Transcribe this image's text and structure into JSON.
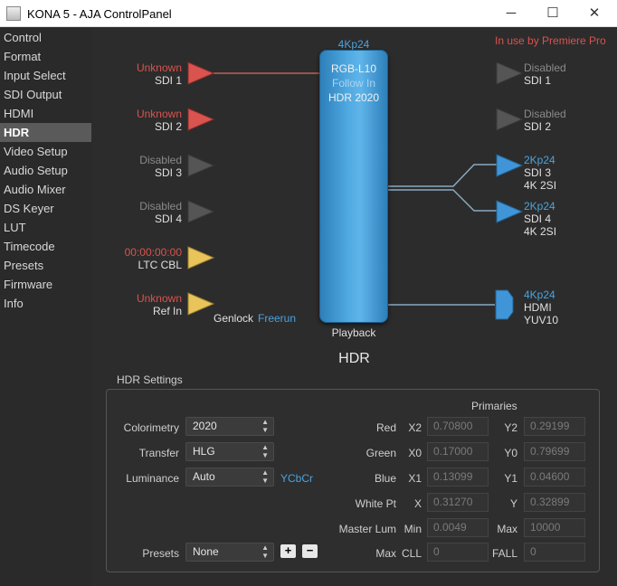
{
  "window": {
    "title": "KONA 5 - AJA ControlPanel",
    "minimize": "─",
    "maximize": "☐",
    "close": "✕"
  },
  "sidebar": {
    "items": [
      {
        "label": "Control"
      },
      {
        "label": "Format"
      },
      {
        "label": "Input Select"
      },
      {
        "label": "SDI Output"
      },
      {
        "label": "HDMI"
      },
      {
        "label": "HDR"
      },
      {
        "label": "Video Setup"
      },
      {
        "label": "Audio Setup"
      },
      {
        "label": "Audio Mixer"
      },
      {
        "label": "DS Keyer"
      },
      {
        "label": "LUT"
      },
      {
        "label": "Timecode"
      },
      {
        "label": "Presets"
      },
      {
        "label": "Firmware"
      },
      {
        "label": "Info"
      }
    ],
    "active": "HDR"
  },
  "status": {
    "in_use": "In use by Premiere Pro"
  },
  "inputs": [
    {
      "status": "Unknown",
      "name": "SDI 1",
      "color": "#d9534f"
    },
    {
      "status": "Unknown",
      "name": "SDI 2",
      "color": "#d9534f"
    },
    {
      "status": "Disabled",
      "name": "SDI 3",
      "color": "#555555"
    },
    {
      "status": "Disabled",
      "name": "SDI 4",
      "color": "#555555"
    },
    {
      "status": "00:00:00:00",
      "name": "LTC CBL",
      "color": "#e8c45a"
    },
    {
      "status": "Unknown",
      "name": "Ref In",
      "color": "#e8c45a"
    }
  ],
  "genlock": {
    "label": "Genlock",
    "value": "Freerun"
  },
  "processor": {
    "format": "4Kp24",
    "line1": "RGB-L10",
    "line2": "Follow In",
    "line3": "HDR 2020",
    "mode": "Playback"
  },
  "outputs": [
    {
      "status": "Disabled",
      "name": "SDI 1",
      "extra": ""
    },
    {
      "status": "Disabled",
      "name": "SDI 2",
      "extra": ""
    },
    {
      "status": "2Kp24",
      "name": "SDI 3",
      "extra": "4K 2SI"
    },
    {
      "status": "2Kp24",
      "name": "SDI 4",
      "extra": "4K 2SI"
    },
    {
      "status": "4Kp24",
      "name": "HDMI",
      "extra": "YUV10"
    }
  ],
  "section_title": "HDR",
  "hdr_settings": {
    "group_label": "HDR Settings",
    "colorimetry": {
      "label": "Colorimetry",
      "value": "2020"
    },
    "transfer": {
      "label": "Transfer",
      "value": "HLG"
    },
    "luminance": {
      "label": "Luminance",
      "value": "Auto",
      "note": "YCbCr"
    },
    "presets": {
      "label": "Presets",
      "value": "None",
      "add": "+",
      "remove": "−"
    },
    "primaries_header": "Primaries",
    "red": {
      "label": "Red",
      "x_label": "X2",
      "x": "0.70800",
      "y_label": "Y2",
      "y": "0.29199"
    },
    "green": {
      "label": "Green",
      "x_label": "X0",
      "x": "0.17000",
      "y_label": "Y0",
      "y": "0.79699"
    },
    "blue": {
      "label": "Blue",
      "x_label": "X1",
      "x": "0.13099",
      "y_label": "Y1",
      "y": "0.04600"
    },
    "white_pt": {
      "label": "White Pt",
      "x_label": "X",
      "x": "0.31270",
      "y_label": "Y",
      "y": "0.32899"
    },
    "master_lum": {
      "label": "Master Lum",
      "min_label": "Min",
      "min": "0.0049",
      "max_label": "Max",
      "max": "10000"
    },
    "cll": {
      "label": "Max",
      "cll_label": "CLL",
      "cll": "0",
      "fall_label": "FALL",
      "fall": "0"
    }
  }
}
